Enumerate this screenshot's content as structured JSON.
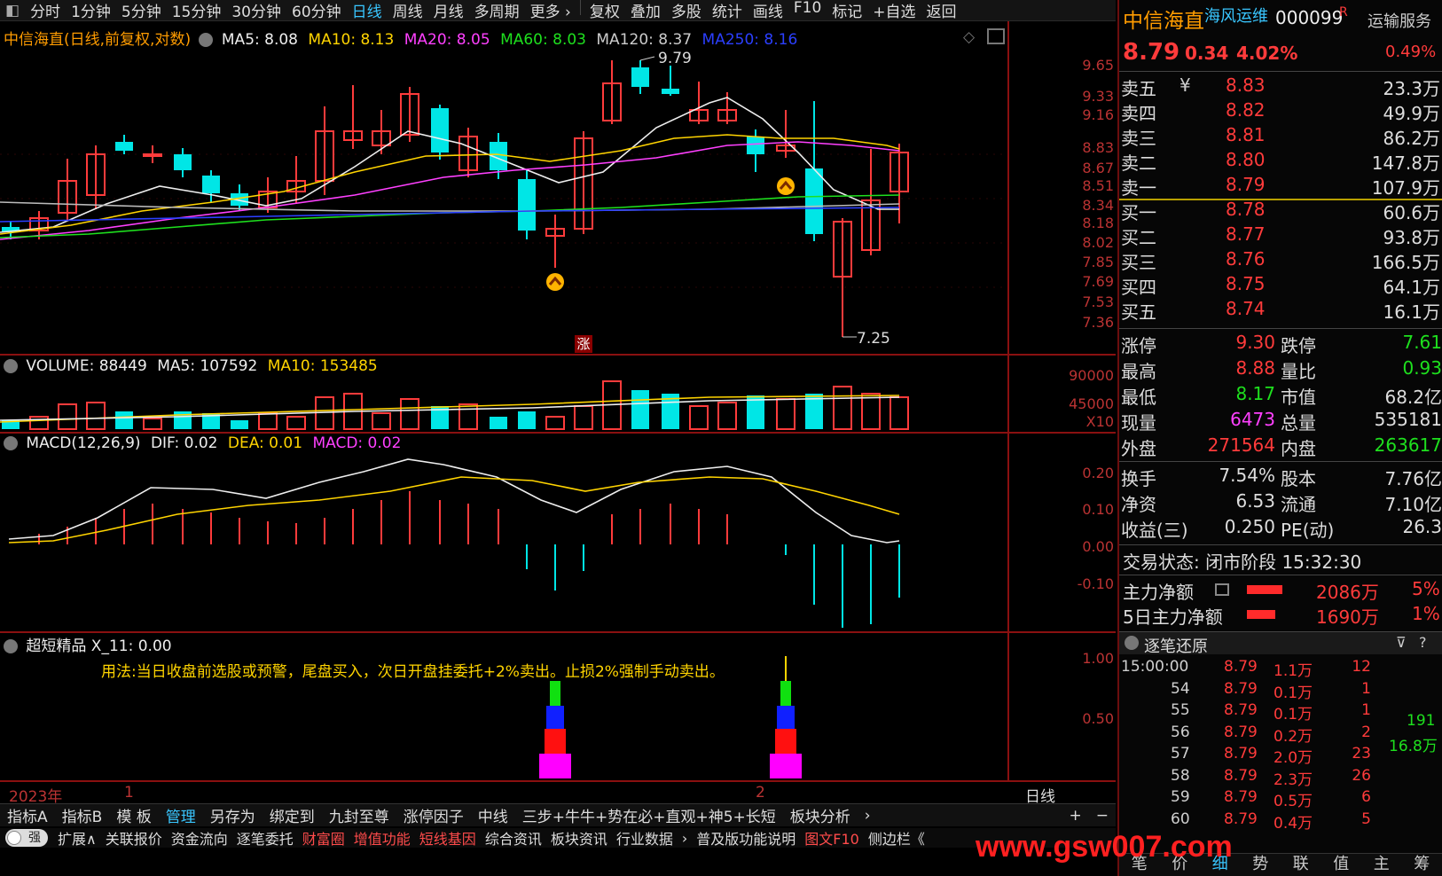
{
  "menu": [
    "分时",
    "1分钟",
    "5分钟",
    "15分钟",
    "30分钟",
    "60分钟",
    "日线",
    "周线",
    "月线",
    "多周期",
    "更多 ›",
    "复权",
    "叠加",
    "多股",
    "统计",
    "画线",
    "F10",
    "标记",
    "+自选",
    "返回"
  ],
  "menu_active": "日线",
  "main_legend": {
    "name": "中信海直(日线,前复权,对数)",
    "ma5": "MA5: 8.08",
    "ma10": "MA10: 8.13",
    "ma20": "MA20: 8.05",
    "ma60": "MA60: 8.03",
    "ma120": "MA120: 8.37",
    "ma250": "MA250: 8.16"
  },
  "price_axis": [
    "9.65",
    "9.33",
    "9.16",
    "8.83",
    "8.67",
    "8.51",
    "8.34",
    "8.18",
    "8.02",
    "7.85",
    "7.69",
    "7.53",
    "7.36"
  ],
  "high_label": "9.79",
  "low_label": "7.25",
  "zhang_badge": "涨",
  "volume_legend": {
    "title": "VOLUME: 88449",
    "ma5": "MA5: 107592",
    "ma10": "MA10: 153485"
  },
  "volume_axis": [
    "90000",
    "45000",
    "X10"
  ],
  "macd_legend": {
    "title": "MACD(12,26,9)",
    "dif": "DIF: 0.02",
    "dea": "DEA: 0.01",
    "macd": "MACD: 0.02"
  },
  "macd_axis": [
    "0.20",
    "0.10",
    "0.00",
    "-0.10"
  ],
  "indicator_legend": {
    "title": "超短精品 X_11: 0.00",
    "usage": "用法:当日收盘前选股或预警，尾盘买入，次日开盘挂委托+2%卖出。止损2%强制手动卖出。"
  },
  "indicator_axis": [
    "1.00",
    "0.50"
  ],
  "time_axis": {
    "year": "2023年",
    "m1": "1",
    "m2": "2",
    "period": "日线"
  },
  "tabs1": [
    "指标A",
    "指标B",
    "模 板",
    "管理",
    "另存为",
    "绑定到",
    "九封至尊",
    "涨停因子",
    "中线",
    "三步+牛牛+势在必+直观+神5+长短",
    "板块分析",
    "›"
  ],
  "tabs1_extra": [
    "+",
    "−"
  ],
  "tabs2": [
    "扩展∧",
    "关联报价",
    "资金流向",
    "逐笔委托",
    "财富圈",
    "增值功能",
    "短线基因",
    "综合资讯",
    "板块资讯",
    "行业数据",
    "›",
    "普及版功能说明",
    "图文F10",
    "侧边栏《"
  ],
  "toggle_label": "强",
  "quote": {
    "name": "中信海直",
    "industry": "海风运维",
    "code": "000099",
    "r": "R",
    "service": "运输服务",
    "price": "8.79",
    "change": "0.34",
    "pct": "4.02%",
    "right_pct": "0.49%",
    "asks": [
      {
        "label": "卖五",
        "price": "8.83",
        "vol": "23.3万"
      },
      {
        "label": "卖四",
        "price": "8.82",
        "vol": "49.9万"
      },
      {
        "label": "卖三",
        "price": "8.81",
        "vol": "86.2万"
      },
      {
        "label": "卖二",
        "price": "8.80",
        "vol": "147.8万"
      },
      {
        "label": "卖一",
        "price": "8.79",
        "vol": "107.9万"
      }
    ],
    "yen": "¥",
    "bids": [
      {
        "label": "买一",
        "price": "8.78",
        "vol": "60.6万"
      },
      {
        "label": "买二",
        "price": "8.77",
        "vol": "93.8万"
      },
      {
        "label": "买三",
        "price": "8.76",
        "vol": "166.5万"
      },
      {
        "label": "买四",
        "price": "8.75",
        "vol": "64.1万"
      },
      {
        "label": "买五",
        "price": "8.74",
        "vol": "16.1万"
      }
    ],
    "stats": [
      {
        "l1": "涨停",
        "v1": "9.30",
        "l2": "跌停",
        "v2": "7.61"
      },
      {
        "l1": "最高",
        "v1": "8.88",
        "l2": "量比",
        "v2": "0.93"
      },
      {
        "l1": "最低",
        "v1": "8.17",
        "l2": "市值",
        "v2": "68.2亿"
      },
      {
        "l1": "现量",
        "v1": "6473",
        "l2": "总量",
        "v2": "535181"
      },
      {
        "l1": "外盘",
        "v1": "271564",
        "l2": "内盘",
        "v2": "263617"
      }
    ],
    "stats2": [
      {
        "l1": "换手",
        "v1": "7.54%",
        "l2": "股本",
        "v2": "7.76亿"
      },
      {
        "l1": "净资",
        "v1": "6.53",
        "l2": "流通",
        "v2": "7.10亿"
      },
      {
        "l1": "收益(三)",
        "v1": "0.250",
        "l2": "PE(动)",
        "v2": "26.3"
      }
    ],
    "trade_status": "交易状态: 闭市阶段 15:32:30",
    "main_net": {
      "label": "主力净额",
      "value": "2086万",
      "pct": "5%"
    },
    "main_net5": {
      "label": "5日主力净额",
      "value": "1690万",
      "pct": "1%"
    },
    "ticks_title": "逐笔还原",
    "ticks": [
      {
        "t": "15:00:00",
        "p": "8.79",
        "v": "1.1万",
        "n": "12"
      },
      {
        "t": "54",
        "p": "8.79",
        "v": "0.1万",
        "n": "1"
      },
      {
        "t": "55",
        "p": "8.79",
        "v": "0.1万",
        "n": "1"
      },
      {
        "t": "56",
        "p": "8.79",
        "v": "0.2万",
        "n": "2"
      },
      {
        "t": "57",
        "p": "8.79",
        "v": "2.0万",
        "n": "23"
      },
      {
        "t": "58",
        "p": "8.79",
        "v": "2.3万",
        "n": "26"
      },
      {
        "t": "59",
        "p": "8.79",
        "v": "0.5万",
        "n": "6"
      },
      {
        "t": "60",
        "p": "8.79",
        "v": "0.4万",
        "n": "5"
      }
    ],
    "side_nums": [
      "191",
      "16.8万"
    ],
    "bottom_tabs": [
      "笔",
      "价",
      "细",
      "势",
      "联",
      "值",
      "主",
      "筹"
    ],
    "watermark": "www.gsw007.com"
  }
}
